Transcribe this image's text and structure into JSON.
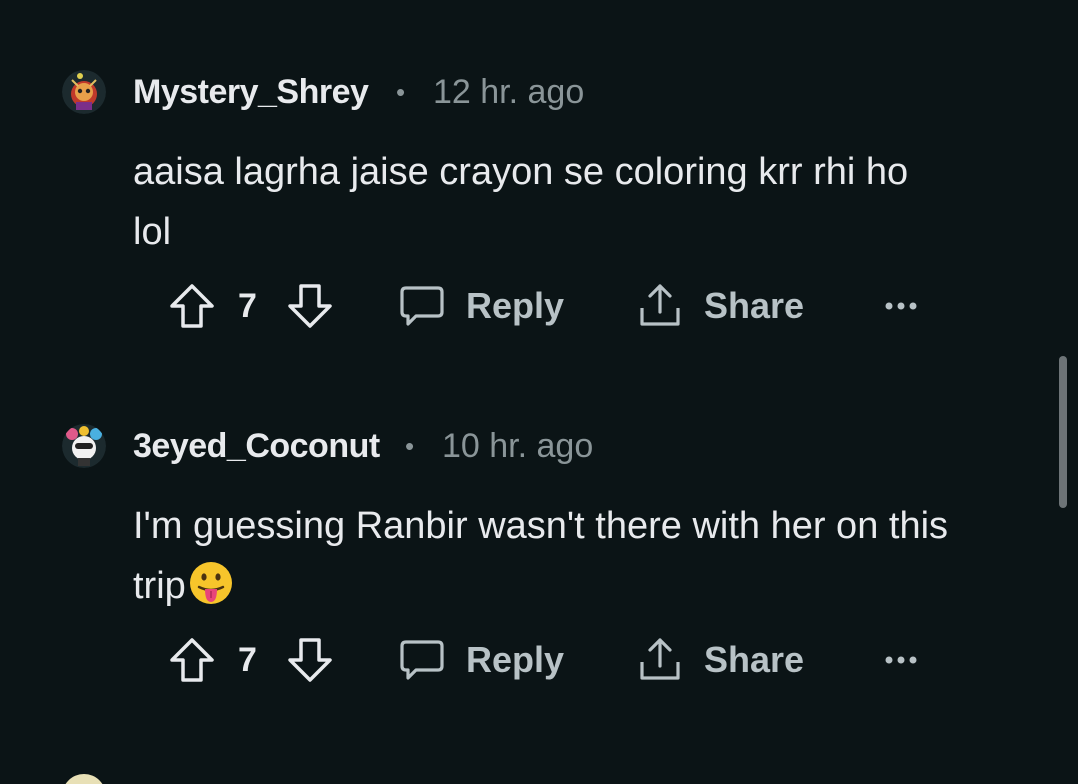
{
  "comments": [
    {
      "username": "Mystery_Shrey",
      "separator": "•",
      "timestamp": "12 hr. ago",
      "body_line1": "aaisa lagrha jaise crayon se coloring krr rhi ho",
      "body_line2": "lol",
      "score": "7",
      "reply_label": "Reply",
      "share_label": "Share",
      "avatar_icon": "snoo-avatar-icon"
    },
    {
      "username": "3eyed_Coconut",
      "separator": "•",
      "timestamp": "10 hr. ago",
      "body_line1": "I'm guessing Ranbir wasn't there with her on this",
      "body_line2": "trip",
      "emoji": "😛",
      "score": "7",
      "reply_label": "Reply",
      "share_label": "Share",
      "avatar_icon": "snoo-avatar-icon"
    }
  ],
  "colors": {
    "background": "#0b1416",
    "text": "#e8eaed",
    "muted": "#8a9598",
    "action": "#b8c2c6"
  }
}
